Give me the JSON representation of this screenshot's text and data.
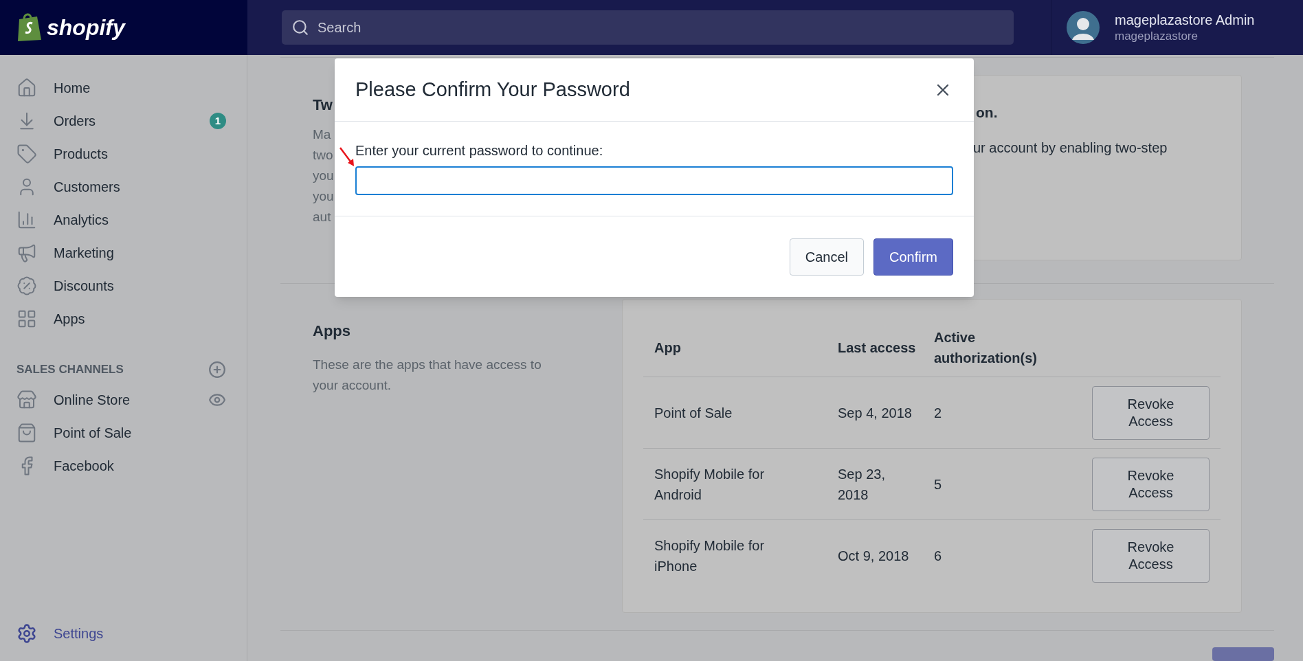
{
  "topbar": {
    "logo": "shopify",
    "search": {
      "placeholder": "Search"
    },
    "user": {
      "name": "mageplazastore Admin",
      "store": "mageplazastore"
    }
  },
  "sidebar": {
    "items": [
      {
        "label": "Home"
      },
      {
        "label": "Orders",
        "badge": "1"
      },
      {
        "label": "Products"
      },
      {
        "label": "Customers"
      },
      {
        "label": "Analytics"
      },
      {
        "label": "Marketing"
      },
      {
        "label": "Discounts"
      },
      {
        "label": "Apps"
      }
    ],
    "channels_heading": "SALES CHANNELS",
    "channels": [
      {
        "label": "Online Store",
        "visible_toggle": true
      },
      {
        "label": "Point of Sale",
        "visible_toggle": false
      },
      {
        "label": "Facebook",
        "visible_toggle": false
      }
    ],
    "settings": "Settings"
  },
  "two_step": {
    "left_fragments": [
      "Tw",
      "Ma",
      "two",
      "you",
      "you",
      "aut"
    ],
    "card_title_fragment": "on.",
    "card_text_fragment": "ur account by enabling two-step"
  },
  "apps": {
    "title": "Apps",
    "description": "These are the apps that have access to your account.",
    "columns": [
      "App",
      "Last access",
      "Active authorization(s)"
    ],
    "rows": [
      {
        "app": "Point of Sale",
        "last_access": "Sep 4, 2018",
        "count": "2",
        "action": "Revoke Access"
      },
      {
        "app": "Shopify Mobile for Android",
        "last_access": "Sep 23, 2018",
        "count": "5",
        "action": "Revoke Access"
      },
      {
        "app": "Shopify Mobile for iPhone",
        "last_access": "Oct 9, 2018",
        "count": "6",
        "action": "Revoke Access"
      }
    ]
  },
  "modal": {
    "title": "Please Confirm Your Password",
    "label": "Enter your current password to continue:",
    "buttons": [
      {
        "label": "Cancel",
        "kind": "secondary"
      },
      {
        "label": "Confirm",
        "kind": "primary"
      }
    ]
  }
}
